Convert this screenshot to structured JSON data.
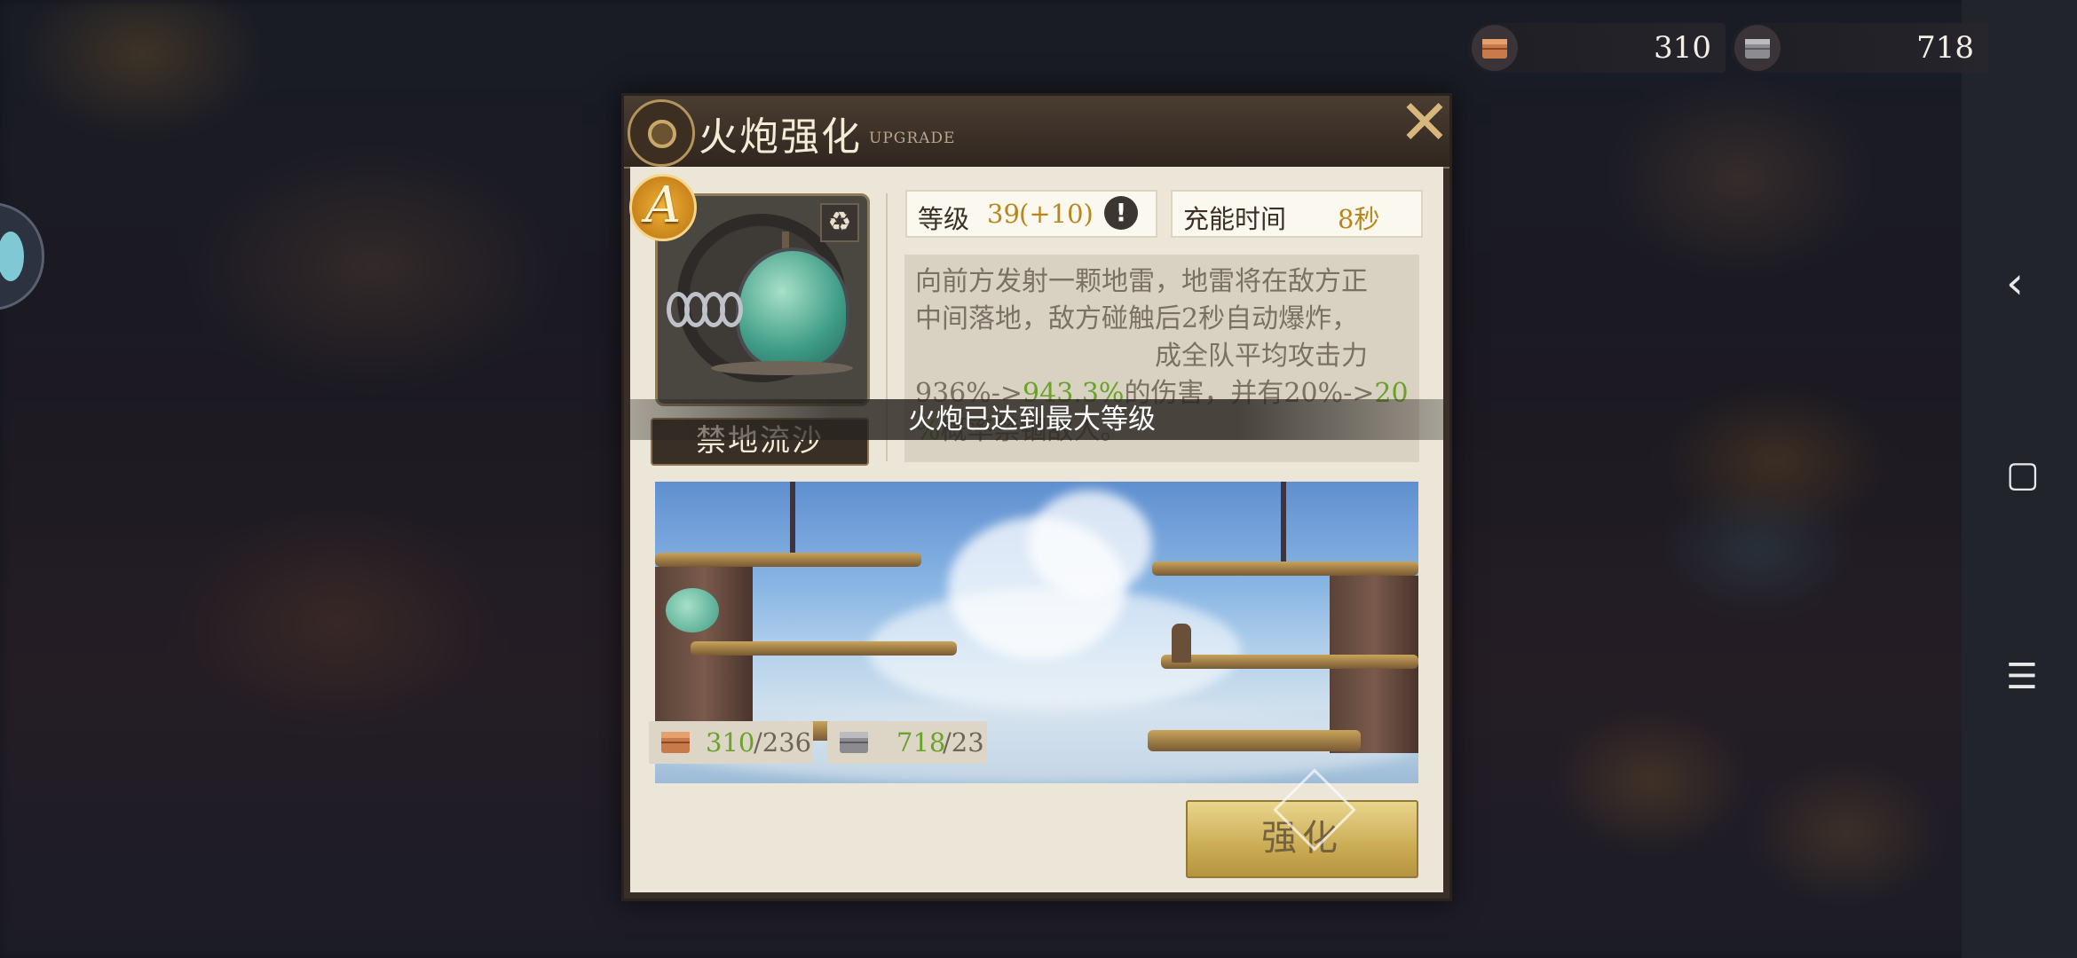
{
  "currencies": [
    {
      "icon": "copper-ingot-icon",
      "value": "310"
    },
    {
      "icon": "iron-ingot-icon",
      "value": "718"
    }
  ],
  "dialog": {
    "title": "火炮强化",
    "subtitle": "UPGRADE",
    "close_symbol": "✕",
    "grade": "A",
    "item_name": "禁地流沙",
    "level_label": "等级",
    "level_value": "39",
    "level_bonus": "(+10)",
    "info_symbol": "!",
    "charge_label": "充能时间",
    "charge_value": "8秒",
    "description": {
      "line1": "向前方发射一颗地雷，地雷将在敌方正",
      "line2": "中间落地，敌方碰触后2秒自动爆炸，",
      "line3_pre": "",
      "line3": "成全队平均攻击力",
      "line4_a": "936%->",
      "line4_b": "943.3%",
      "line4_c": "的伤害，并有20%->",
      "line4_d": "20",
      "line5_a": "%",
      "line5_b": "概率禁锢敌人。"
    },
    "toast": "火炮已达到最大等级",
    "costs": [
      {
        "icon": "copper-ingot-icon",
        "have": "310",
        "need": "/236"
      },
      {
        "icon": "iron-ingot-icon",
        "have": "718",
        "need": "/23"
      }
    ],
    "upgrade_button": "强化"
  },
  "nav": {
    "back": "‹",
    "home": "▢",
    "menu": "☰"
  },
  "colors": {
    "accent_gold": "#b8861a",
    "accent_green": "#6aa22a",
    "panel": "#ece6d8"
  }
}
